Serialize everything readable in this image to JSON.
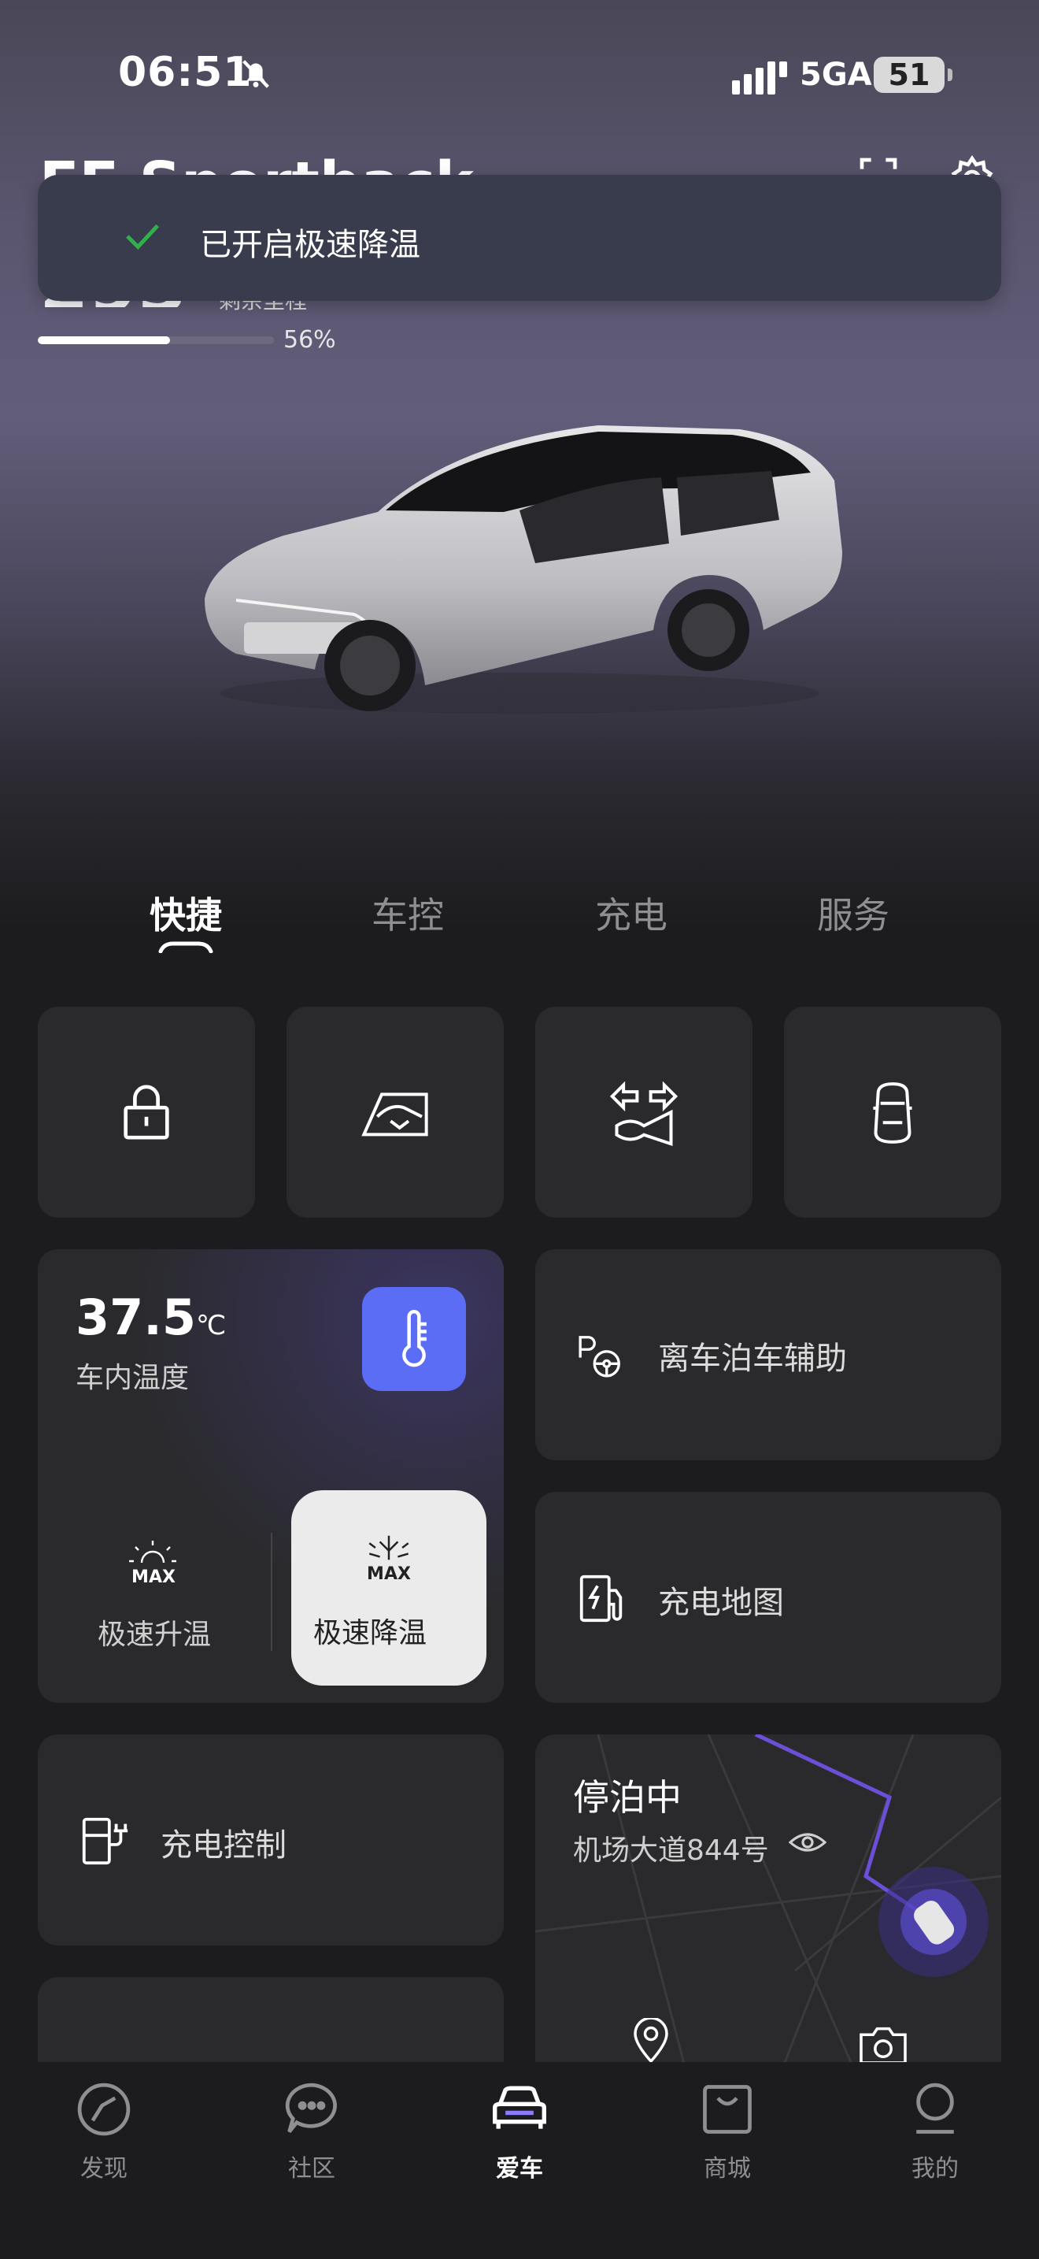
{
  "status_bar": {
    "time": "06:51",
    "network": "5GA",
    "battery": "51"
  },
  "vehicle": {
    "name": "EE Sportback",
    "range": "293",
    "range_label": "剩余里程",
    "battery_percent": 56,
    "battery_label": "56%"
  },
  "toast": {
    "message": "已开启极速降温"
  },
  "tabs": [
    {
      "label": "快捷"
    },
    {
      "label": "车控"
    },
    {
      "label": "充电"
    },
    {
      "label": "服务"
    }
  ],
  "climate": {
    "temperature": "37.5",
    "unit": "℃",
    "label": "车内温度",
    "heat_tag": "MAX",
    "heat_label": "极速升温",
    "cool_tag": "MAX",
    "cool_label": "极速降温"
  },
  "cards": {
    "leave_parking": "离车泊车辅助",
    "charge_map": "充电地图",
    "charge_control": "充电控制"
  },
  "parking": {
    "status": "停泊中",
    "address": "机场大道844号"
  },
  "bottom_nav": [
    {
      "label": "发现"
    },
    {
      "label": "社区"
    },
    {
      "label": "爱车"
    },
    {
      "label": "商城"
    },
    {
      "label": "我的"
    }
  ],
  "colors": {
    "accent": "#5b6cf5",
    "route": "#6b4fd8",
    "check": "#2fb24a"
  }
}
